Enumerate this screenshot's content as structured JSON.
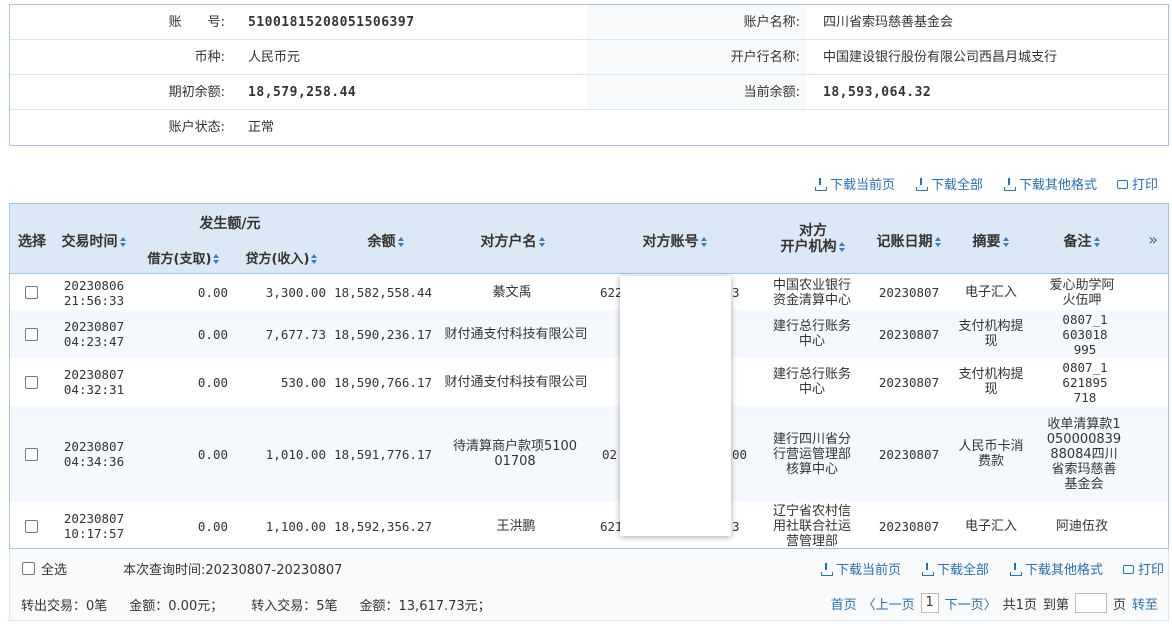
{
  "account": {
    "account_no_label": "账　　号:",
    "account_no": "51001815208051506397",
    "account_name_label": "账户名称:",
    "account_name": "四川省索玛慈善基金会",
    "currency_label": "币种:",
    "currency": "人民币元",
    "bank_label": "开户行名称:",
    "bank": "中国建设银行股份有限公司西昌月城支行",
    "opening_balance_label": "期初余额:",
    "opening_balance": "18,579,258.44",
    "current_balance_label": "当前余额:",
    "current_balance": "18,593,064.32",
    "status_label": "账户状态:",
    "status": "正常"
  },
  "actions": {
    "download_page": "下载当前页",
    "download_all": "下载全部",
    "download_other": "下载其他格式",
    "print": "打印"
  },
  "table": {
    "headers": {
      "select": "选择",
      "time": "交易时间",
      "amount_group": "发生额/元",
      "debit": "借方(支取)",
      "credit": "贷方(收入)",
      "balance": "余额",
      "cp_name": "对方户名",
      "cp_account": "对方账号",
      "cp_bank_1": "对方",
      "cp_bank_2": "开户机构",
      "book_date": "记账日期",
      "summary": "摘要",
      "remark": "备注",
      "expand": "»"
    },
    "rows": [
      {
        "date": "20230806",
        "time": "21:56:33",
        "debit": "0.00",
        "credit": "3,300.00",
        "balance": "18,582,558.44",
        "cp_name": "綦文禹",
        "cp_account_left": "622",
        "cp_account_right": "3",
        "cp_bank": "中国农业银行资金清算中心",
        "book_date": "20230807",
        "summary": "电子汇入",
        "remark": "爱心助学阿火伍呷"
      },
      {
        "date": "20230807",
        "time": "04:23:47",
        "debit": "0.00",
        "credit": "7,677.73",
        "balance": "18,590,236.17",
        "cp_name": "财付通支付科技有限公司",
        "cp_account_left": "",
        "cp_account_right": "",
        "cp_bank": "建行总行账务中心",
        "book_date": "20230807",
        "summary": "支付机构提现",
        "remark": "0807_1603018995"
      },
      {
        "date": "20230807",
        "time": "04:32:31",
        "debit": "0.00",
        "credit": "530.00",
        "balance": "18,590,766.17",
        "cp_name": "财付通支付科技有限公司",
        "cp_account_left": "",
        "cp_account_right": "",
        "cp_bank": "建行总行账务中心",
        "book_date": "20230807",
        "summary": "支付机构提现",
        "remark": "0807_1621895718"
      },
      {
        "date": "20230807",
        "time": "04:34:36",
        "debit": "0.00",
        "credit": "1,010.00",
        "balance": "18,591,776.17",
        "cp_name": "待清算商户款项510001708",
        "cp_account_left": "02",
        "cp_account_right": "00",
        "cp_bank": "建行四川省分行营运管理部核算中心",
        "book_date": "20230807",
        "summary": "人民币卡消费款",
        "remark": "收单清算款105000083988084四川省索玛慈善基金会"
      },
      {
        "date": "20230807",
        "time": "10:17:57",
        "debit": "0.00",
        "credit": "1,100.00",
        "balance": "18,592,356.27",
        "cp_name": "王洪鹏",
        "cp_account_left": "621",
        "cp_account_right": "3",
        "cp_bank": "辽宁省农村信用社联合社运营管理部",
        "book_date": "20230807",
        "summary": "电子汇入",
        "remark": "阿迪伍孜"
      }
    ]
  },
  "footer": {
    "select_all": "全选",
    "query_time": "本次查询时间:20230807-20230807",
    "summary_out": "转出交易：0笔",
    "summary_out_amount": "金额：0.00元；",
    "summary_in": "转入交易：5笔",
    "summary_in_amount": "金额：13,617.73元；",
    "pager": {
      "first": "首页",
      "prev": "〈上一页",
      "current": "1",
      "next": "下一页〉",
      "total": "共1页",
      "goto": "到第",
      "page_unit": "页",
      "go": "转至"
    }
  }
}
